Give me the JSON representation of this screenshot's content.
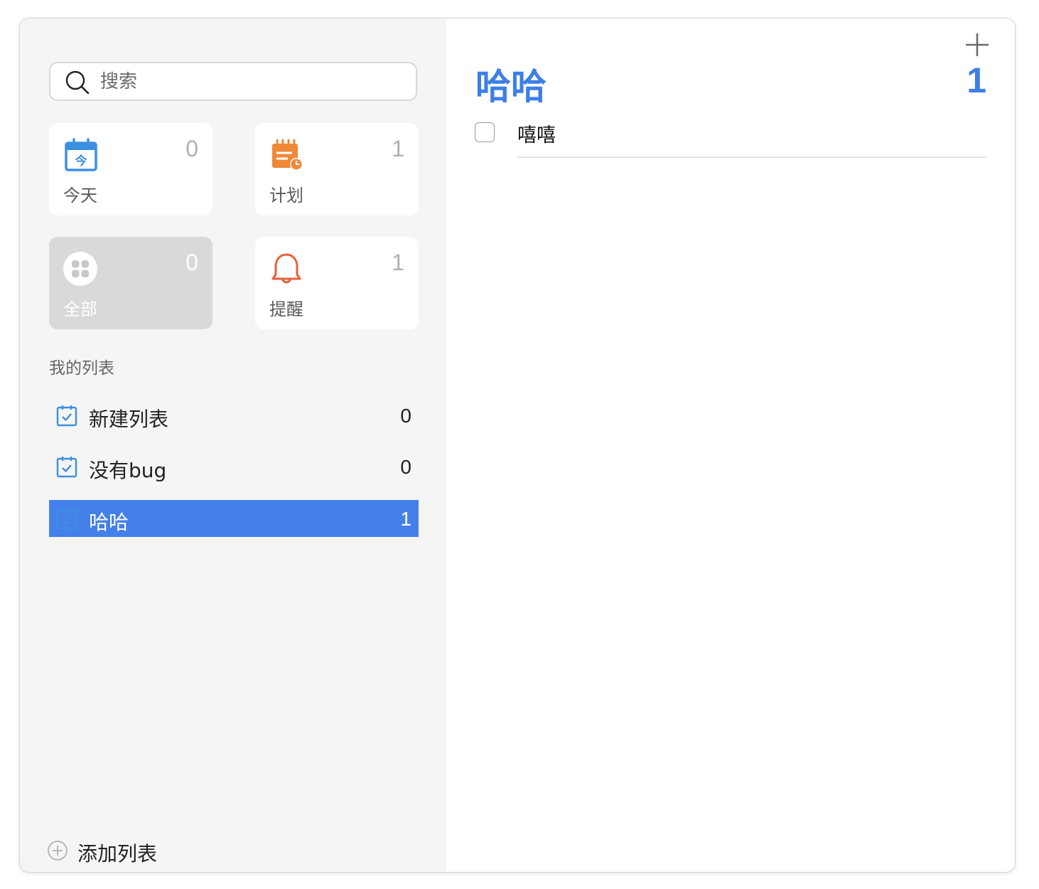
{
  "search": {
    "placeholder": "搜索"
  },
  "smart_lists": [
    {
      "label": "今天",
      "count": "0",
      "icon": "calendar-today-icon",
      "color": "#3d8fe0"
    },
    {
      "label": "计划",
      "count": "1",
      "icon": "scheduled-icon",
      "color": "#f0883a"
    },
    {
      "label": "全部",
      "count": "0",
      "icon": "all-grid-icon",
      "color": "#b5b5b5"
    },
    {
      "label": "提醒",
      "count": "1",
      "icon": "bell-icon",
      "color": "#e8603c"
    }
  ],
  "my_lists_title": "我的列表",
  "lists": [
    {
      "name": "新建列表",
      "count": "0"
    },
    {
      "name": "没有bug",
      "count": "0"
    },
    {
      "name": "哈哈",
      "count": "1"
    }
  ],
  "add_list_label": "添加列表",
  "main": {
    "title": "哈哈",
    "count": "1",
    "tasks": [
      {
        "text": "嘻嘻",
        "done": false
      }
    ]
  },
  "colors": {
    "accent": "#4480ea",
    "title": "#3d7fe6",
    "sidebar_bg": "#f5f5f5"
  }
}
